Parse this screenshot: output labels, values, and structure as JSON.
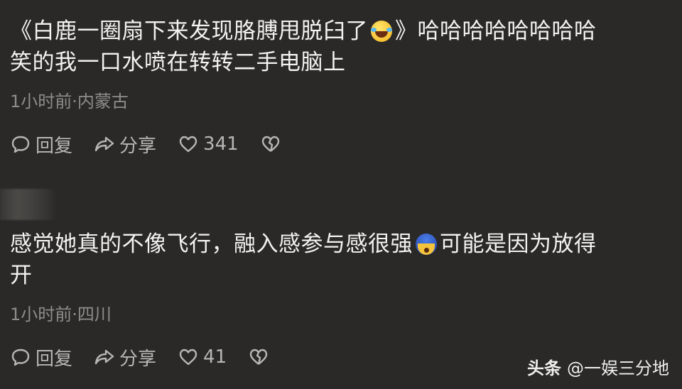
{
  "comments": [
    {
      "text_before_emoji": "《白鹿一圈扇下来发现胳膊甩脱臼了",
      "emoji": "grinning-squinting-tears-emoji",
      "text_after_emoji": "》哈哈哈哈哈哈哈哈",
      "text_line2": "笑的我一口水喷在转转二手电脑上",
      "meta": "1小时前·内蒙古",
      "reply_label": "回复",
      "share_label": "分享",
      "like_count": "341"
    },
    {
      "text_before_emoji": "感觉她真的不像飞行，融入感参与感很强",
      "emoji": "shocked-blue-face-emoji",
      "text_after_emoji": "可能是因为放得",
      "text_line2": "开",
      "meta": "1小时前·四川",
      "reply_label": "回复",
      "share_label": "分享",
      "like_count": "41"
    }
  ],
  "watermark": {
    "brand": "头条",
    "handle": "@一娱三分地"
  },
  "colors": {
    "background": "#2a2928",
    "text": "#f3f2f0",
    "meta": "#8f8d8a",
    "action": "#b8b6b2"
  }
}
